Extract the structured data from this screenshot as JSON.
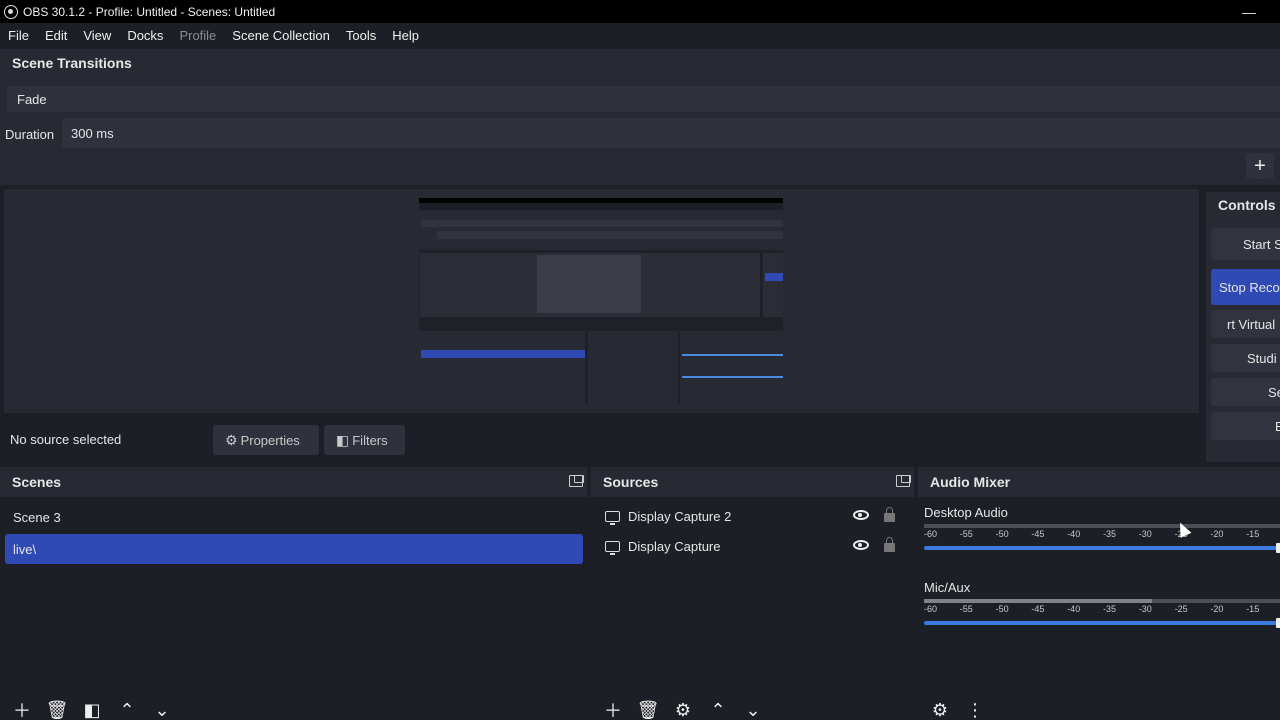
{
  "window": {
    "title": "OBS 30.1.2 - Profile: Untitled - Scenes: Untitled",
    "minimize": "—"
  },
  "menu": [
    "File",
    "Edit",
    "View",
    "Docks",
    "Profile",
    "Scene Collection",
    "Tools",
    "Help"
  ],
  "scene_transitions": {
    "title": "Scene Transitions",
    "transition": "Fade",
    "duration_label": "Duration",
    "duration_value": "300 ms",
    "add": "+"
  },
  "preview": {
    "no_source": "No source selected",
    "properties": "Properties",
    "filters": "Filters"
  },
  "controls": {
    "title": "Controls",
    "buttons": [
      "Start St",
      "Stop Reco",
      "rt Virtual",
      "Studi",
      "Set",
      "E"
    ]
  },
  "scenes": {
    "title": "Scenes",
    "items": [
      "Scene 3",
      "live\\"
    ],
    "selected": 1
  },
  "sources": {
    "title": "Sources",
    "items": [
      "Display Capture 2",
      "Display Capture"
    ]
  },
  "audio_mixer": {
    "title": "Audio Mixer",
    "channels": [
      {
        "name": "Desktop Audio",
        "level": 0
      },
      {
        "name": "Mic/Aux",
        "level": 0.64
      }
    ],
    "ticks": [
      "-60",
      "-55",
      "-50",
      "-45",
      "-40",
      "-35",
      "-30",
      "-25",
      "-20",
      "-15"
    ]
  },
  "colors": {
    "accent": "#2f49b5",
    "background": "#1d1f26",
    "panel": "#272a33"
  }
}
